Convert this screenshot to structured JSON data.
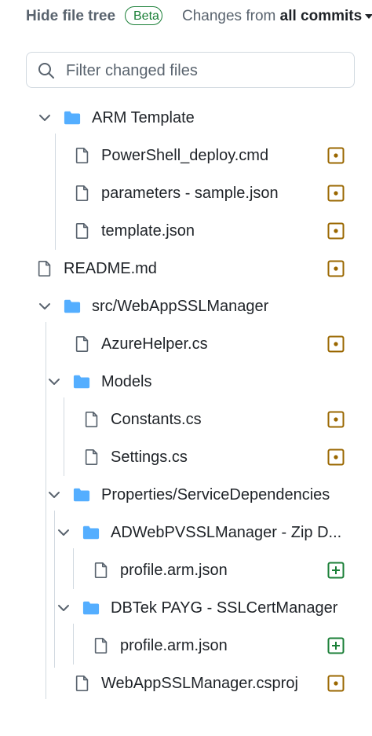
{
  "header": {
    "hide_tree_label": "Hide file tree",
    "beta_badge": "Beta",
    "changes_prefix": "Changes from ",
    "changes_value": "all commits"
  },
  "filter": {
    "placeholder": "Filter changed files",
    "value": ""
  },
  "colors": {
    "folder": "#54aeff",
    "modified": "#9a6700",
    "added": "#1a7f37",
    "text": "#1f2328",
    "muted": "#59636e"
  },
  "tree": {
    "arm_template": "ARM Template",
    "powershell_deploy": "PowerShell_deploy.cmd",
    "parameters_sample": "parameters - sample.json",
    "template_json": "template.json",
    "readme": "README.md",
    "src_folder": "src/WebAppSSLManager",
    "azure_helper": "AzureHelper.cs",
    "models": "Models",
    "constants": "Constants.cs",
    "settings": "Settings.cs",
    "properties": "Properties/ServiceDependencies",
    "adweb_folder": "ADWebPVSSLManager - Zip D...",
    "profile_arm_1": "profile.arm.json",
    "dbtek_folder": "DBTek PAYG - SSLCertManager",
    "profile_arm_2": "profile.arm.json",
    "csproj": "WebAppSSLManager.csproj"
  },
  "status": {
    "powershell_deploy": "modified",
    "parameters_sample": "modified",
    "template_json": "modified",
    "readme": "modified",
    "azure_helper": "modified",
    "constants": "modified",
    "settings": "modified",
    "profile_arm_1": "added",
    "profile_arm_2": "added",
    "csproj": "modified"
  }
}
